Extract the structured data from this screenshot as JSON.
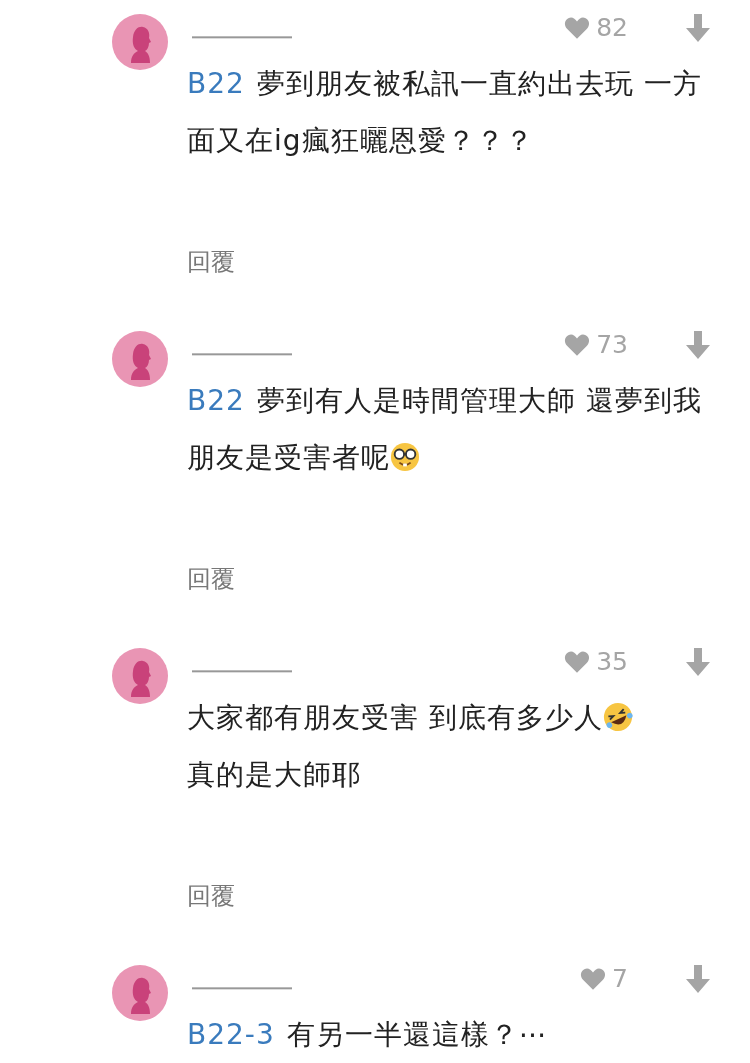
{
  "comments": [
    {
      "likes": "82",
      "floor": "B22",
      "text": "夢到朋友被私訊一直約出去玩 一方面又在ig瘋狂曬恩愛？？？",
      "reply": "回覆"
    },
    {
      "likes": "73",
      "floor": "B22",
      "text": "夢到有人是時間管理大師 還夢到我朋友是受害者呢",
      "emoji": {
        "kind": "nerd"
      },
      "reply": "回覆"
    },
    {
      "likes": "35",
      "text": "大家都有朋友受害 到底有多少人",
      "emoji": {
        "kind": "rofl"
      },
      "text_after": "真的是大師耶",
      "reply": "回覆"
    },
    {
      "likes": "7",
      "floor": "B22-3",
      "text": "有另一半還這樣？⋯"
    }
  ]
}
